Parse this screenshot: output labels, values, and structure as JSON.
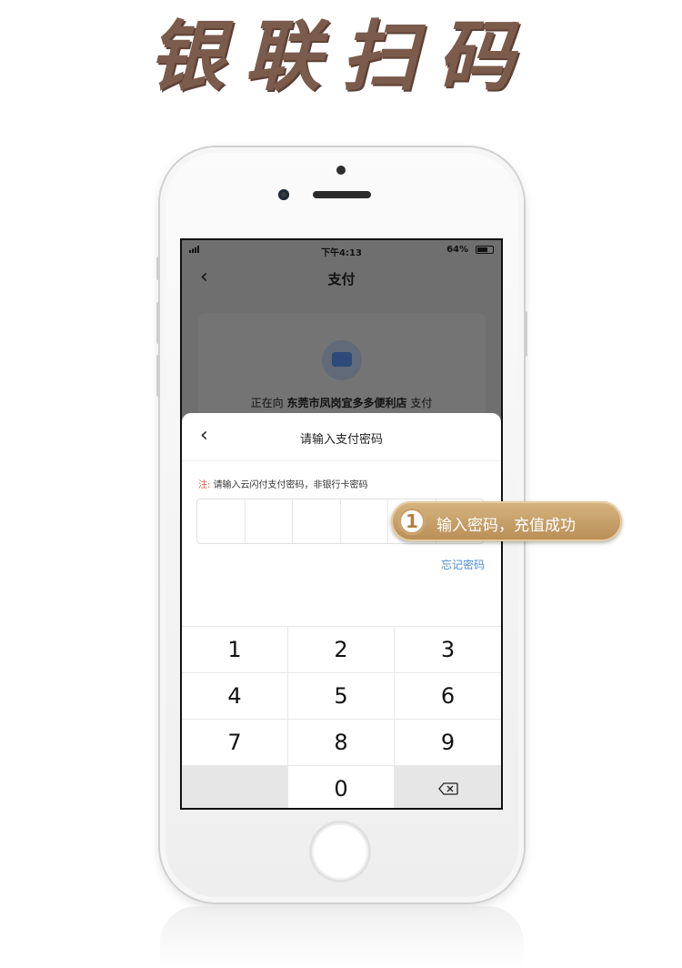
{
  "header_title": "银联扫码",
  "status_bar": {
    "time": "下午4:13",
    "battery": "64%"
  },
  "nav": {
    "title": "支付"
  },
  "merchant": {
    "prefix": "正在向",
    "name": "东莞市凤岗宜多多便利店",
    "suffix": "支付"
  },
  "sheet": {
    "title": "请输入支付密码",
    "note_label": "注:",
    "note_text": "请输入云闪付支付密码，非银行卡密码",
    "forgot": "忘记密码"
  },
  "keypad": [
    "1",
    "2",
    "3",
    "4",
    "5",
    "6",
    "7",
    "8",
    "9",
    "",
    "0",
    "⌫"
  ],
  "callout": {
    "number": "1",
    "text": "输入密码，充值成功"
  },
  "colors": {
    "accent_gold": "#c9a26d",
    "link_blue": "#4a8cd6",
    "note_red": "#e5533d",
    "title_brown": "#7b5b4c"
  }
}
